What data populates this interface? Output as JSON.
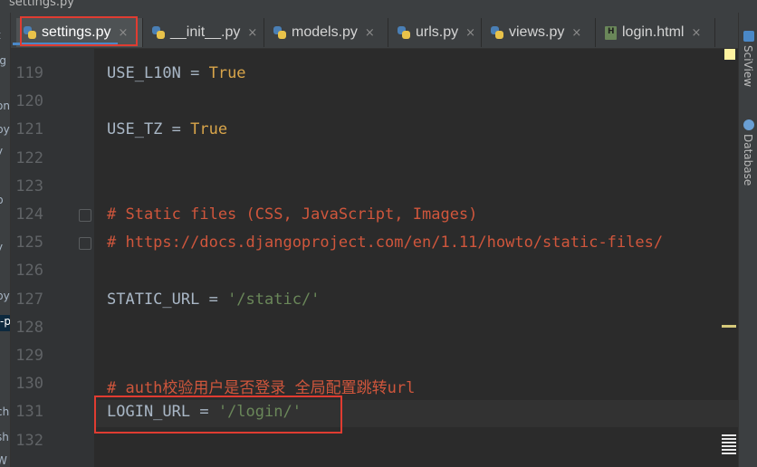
{
  "window": {
    "title": "settings.py"
  },
  "left_strip": {
    "fragments": [
      "t",
      "ig",
      "on",
      "py",
      "y",
      "p",
      "y",
      "py",
      "-p",
      "ch",
      "sh",
      "W"
    ]
  },
  "tabs": [
    {
      "label": "settings.py",
      "icon": "python-file-icon",
      "active": true
    },
    {
      "label": "__init__.py",
      "icon": "python-file-icon",
      "active": false
    },
    {
      "label": "models.py",
      "icon": "python-file-icon",
      "active": false
    },
    {
      "label": "urls.py",
      "icon": "python-file-icon",
      "active": false
    },
    {
      "label": "views.py",
      "icon": "python-file-icon",
      "active": false
    },
    {
      "label": "login.html",
      "icon": "html-file-icon",
      "active": false
    }
  ],
  "tab_close_glyph": "×",
  "editor": {
    "lines": [
      {
        "num": "119",
        "tokens": [
          {
            "t": "USE_L10N = ",
            "c": "plain"
          },
          {
            "t": "True",
            "c": "true"
          }
        ]
      },
      {
        "num": "120",
        "tokens": []
      },
      {
        "num": "121",
        "tokens": [
          {
            "t": "USE_TZ = ",
            "c": "plain"
          },
          {
            "t": "True",
            "c": "true"
          }
        ]
      },
      {
        "num": "122",
        "tokens": []
      },
      {
        "num": "123",
        "tokens": []
      },
      {
        "num": "124",
        "tokens": [
          {
            "t": "# Static files (CSS, JavaScript, Images)",
            "c": "comment"
          }
        ]
      },
      {
        "num": "125",
        "tokens": [
          {
            "t": "# https://docs.djangoproject.com/en/1.11/howto/static-files/",
            "c": "comment"
          }
        ]
      },
      {
        "num": "126",
        "tokens": []
      },
      {
        "num": "127",
        "tokens": [
          {
            "t": "STATIC_URL = ",
            "c": "plain"
          },
          {
            "t": "'/static/'",
            "c": "str"
          }
        ]
      },
      {
        "num": "128",
        "tokens": []
      },
      {
        "num": "129",
        "tokens": []
      },
      {
        "num": "130",
        "tokens": [
          {
            "t": "# auth校验用户是否登录 全局配置跳转url",
            "c": "comment"
          }
        ]
      },
      {
        "num": "131",
        "tokens": [
          {
            "t": "LOGIN_URL = ",
            "c": "plain"
          },
          {
            "t": "'/login/'",
            "c": "str"
          }
        ]
      },
      {
        "num": "132",
        "tokens": []
      }
    ],
    "current_line": "131"
  },
  "right_tools": [
    {
      "label": "SciView",
      "icon": "sciview-icon",
      "color": "#4a88c7"
    },
    {
      "label": "Database",
      "icon": "database-icon",
      "color": "#6a9fd4"
    }
  ],
  "colors": {
    "background": "#2b2b2b",
    "gutter": "#313335",
    "comment": "#d0563c",
    "string": "#6a8759",
    "true_keyword": "#d9a54a",
    "annotation_box": "#e03c31",
    "active_tab_underline": "#4a88c7"
  }
}
